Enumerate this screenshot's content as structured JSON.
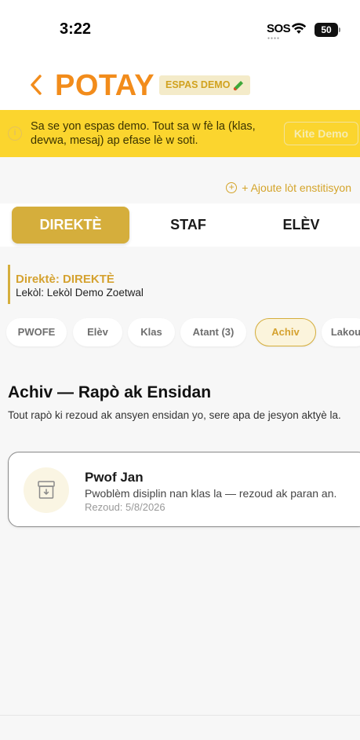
{
  "status_bar": {
    "time": "3:22",
    "sos": "SOS",
    "battery": "50"
  },
  "header": {
    "title": "POTAY",
    "demo_badge": "ESPAS DEMO",
    "badge_icon": "test-tube-icon",
    "back_icon": "chevron-left-icon"
  },
  "demo_banner": {
    "text": "Sa se yon espas demo. Tout sa w fè la (klas, devwa, mesaj) ap efase lè w soti.",
    "exit_button": "Kite Demo",
    "icon": "info-icon"
  },
  "add_institution": "+ Ajoute lòt enstitisyon",
  "role_tabs": [
    {
      "label": "DIREKTÈ",
      "active": true
    },
    {
      "label": "STAF",
      "active": false
    },
    {
      "label": "ELÈV",
      "active": false
    }
  ],
  "role_info": {
    "role": "Direktè: DIREKTÈ",
    "school": "Lekòl: Lekòl Demo Zoetwal"
  },
  "chips": [
    {
      "label": "PWOFE",
      "active": false
    },
    {
      "label": "Elèv",
      "active": false
    },
    {
      "label": "Klas",
      "active": false
    },
    {
      "label": "Atant (3)",
      "active": false
    },
    {
      "label": "Achiv",
      "active": true
    },
    {
      "label": "Lakou",
      "active": false
    }
  ],
  "section": {
    "title": "Achiv — Rapò ak Ensidan",
    "description": "Tout rapò ki rezoud ak ansyen ensidan yo, sere apa de jesyon aktyè la."
  },
  "reports": [
    {
      "title": "Pwof Jan",
      "description": "Pwoblèm disiplin nan klas la — rezoud ak paran an.",
      "date": "Rezoud: 5/8/2026",
      "icon": "archive-icon"
    }
  ],
  "colors": {
    "brand_orange": "#f28c1b",
    "gold": "#d5ae3c",
    "banner_yellow": "#fbd52e"
  }
}
